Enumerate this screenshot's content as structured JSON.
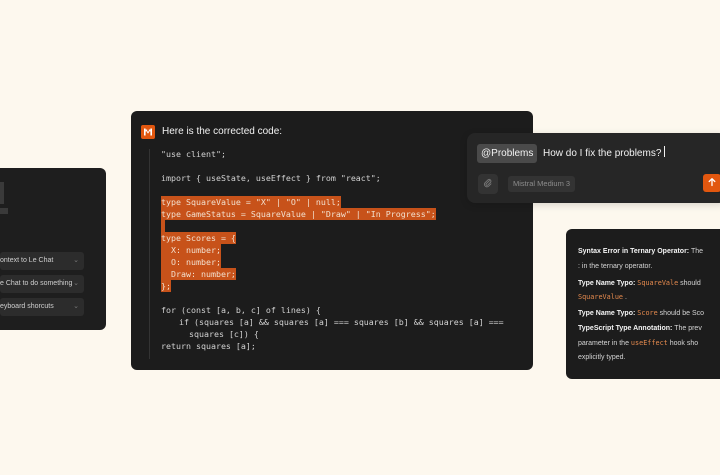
{
  "left_panel": {
    "menu_items": [
      {
        "label": "ontext to Le Chat"
      },
      {
        "label": "e Chat to do something"
      },
      {
        "label": "eyboard shorcuts"
      }
    ],
    "chevron_icon": "chevron-down-icon"
  },
  "code_panel": {
    "title": "Here is the corrected code:",
    "logo_icon": "mistral-logo-icon",
    "code": {
      "l1": "\"use client\";",
      "l2": "import { useState, useEffect } from \"react\";",
      "l3": "type SquareValue = \"X\" | \"O\" | null;",
      "l4": "type GameStatus = SquareValue | \"Draw\" | \"In Progress\";",
      "l5": "type Scores = {",
      "l6": "  X: number;",
      "l7": "  O: number;",
      "l8": "  Draw: number;",
      "l9": "};",
      "l10": "for (const [a, b, c] of lines) {",
      "l11": "  if (squares [a] && squares [a] === squares [b] && squares [a] ===",
      "l12": "    squares [c]) {",
      "l13": "return squares [a];"
    }
  },
  "chat": {
    "mention": "@Problems",
    "input_text": "How do I fix the problems?",
    "model": "Mistral Medium 3",
    "attach_icon": "paperclip-icon",
    "send_icon": "arrow-up-icon",
    "accent_color": "#e2570f"
  },
  "errors": {
    "e1_title": "Syntax Error in Ternary Operator:",
    "e1_text": " The",
    "e1_cont": ": in the ternary operator.",
    "e2_title": "Type Name Typo:",
    "e2_code": "SquareVale",
    "e2_text": " should",
    "e2_cont": "SquareValue",
    "e2_cont_after": " .",
    "e3_title": "Type Name Typo:",
    "e3_code": "Score",
    "e3_text": " should be Sco",
    "e4_title": "TypeScript Type Annotation:",
    "e4_text": " The prev",
    "e4_cont_before": "parameter in the ",
    "e4_cont_code": "useEffect",
    "e4_cont_after": " hook sho",
    "e4_cont2": "explicitly typed."
  }
}
